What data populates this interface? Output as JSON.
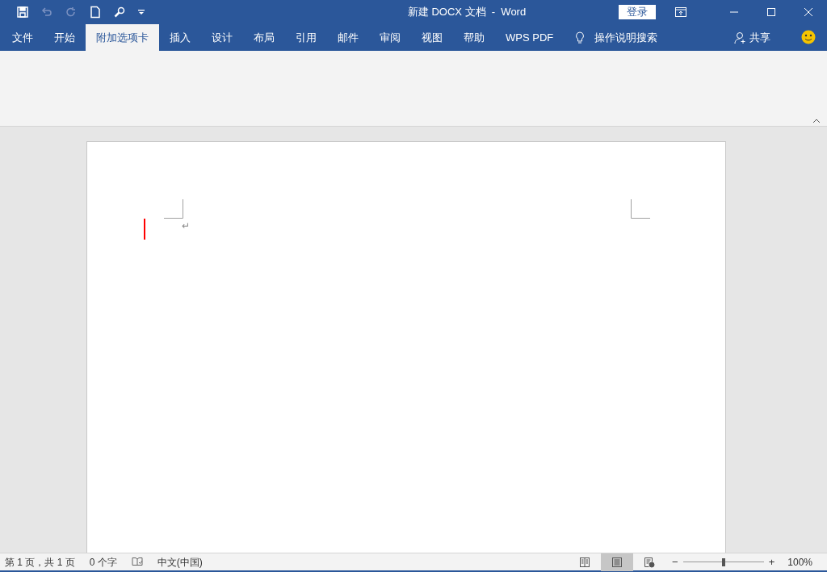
{
  "window": {
    "title": "新建 DOCX 文档  -  Word",
    "sign_in": "登录"
  },
  "quick_access": [
    {
      "kind": "save",
      "disabled": false
    },
    {
      "kind": "undo",
      "disabled": true
    },
    {
      "kind": "redo",
      "disabled": true
    },
    {
      "kind": "new",
      "disabled": false
    },
    {
      "kind": "find",
      "disabled": false
    },
    {
      "kind": "customize",
      "disabled": false
    }
  ],
  "tabs": [
    {
      "label": "文件",
      "selected": false
    },
    {
      "label": "开始",
      "selected": false
    },
    {
      "label": "附加选项卡",
      "selected": true
    },
    {
      "label": "插入",
      "selected": false
    },
    {
      "label": "设计",
      "selected": false
    },
    {
      "label": "布局",
      "selected": false
    },
    {
      "label": "引用",
      "selected": false
    },
    {
      "label": "邮件",
      "selected": false
    },
    {
      "label": "审阅",
      "selected": false
    },
    {
      "label": "视图",
      "selected": false
    },
    {
      "label": "帮助",
      "selected": false
    },
    {
      "label": "WPS PDF",
      "selected": false
    }
  ],
  "tell_me": "操作说明搜索",
  "share": "共享",
  "document": {
    "paragraph_mark": "↵"
  },
  "status_bar": {
    "page": "第 1 页，共 1 页",
    "words": "0 个字",
    "language": "中文(中国)",
    "views": [
      {
        "kind": "read",
        "selected": false
      },
      {
        "kind": "print",
        "selected": true
      },
      {
        "kind": "web",
        "selected": false
      }
    ],
    "zoom_out": "−",
    "zoom_in": "+",
    "zoom": {
      "level": 0.5
    },
    "zoom_label": "100%"
  }
}
